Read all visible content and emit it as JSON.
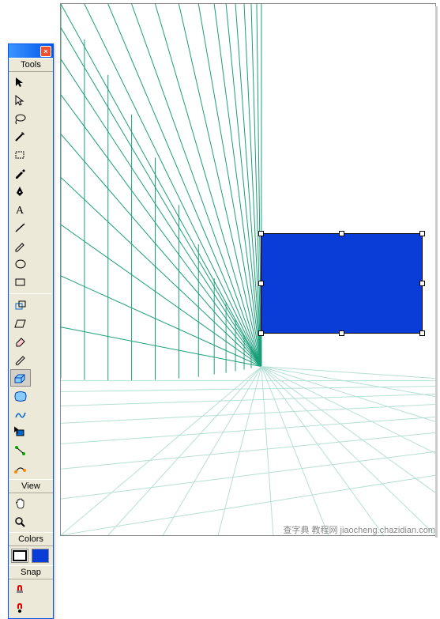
{
  "panel": {
    "sections": {
      "tools": "Tools",
      "view": "View",
      "colors": "Colors",
      "snap": "Snap"
    }
  },
  "tools": {
    "pointer": "pointer",
    "subselect": "subselect",
    "lasso": "lasso",
    "magic_wand": "magic-wand",
    "crop": "crop",
    "eyedropper": "eyedropper",
    "pen": "pen",
    "text": "text",
    "line": "line",
    "pencil": "pencil",
    "ellipse": "ellipse",
    "rectangle": "rectangle",
    "scale": "scale",
    "skew": "skew",
    "eraser": "eraser",
    "knife": "knife",
    "extrude": "extrude",
    "envelope": "envelope",
    "trace": "trace",
    "perspective": "perspective",
    "connector": "connector",
    "graphic_hose": "graphic-hose"
  },
  "view": {
    "hand": "hand",
    "zoom": "zoom"
  },
  "colors": {
    "stroke": "#000000",
    "fill": "#0a3dd8"
  },
  "snap": {
    "snap_object": "snap-object",
    "snap_point": "snap-point"
  },
  "watermark": "查字典 教程网 jiaocheng.chazidian.com"
}
